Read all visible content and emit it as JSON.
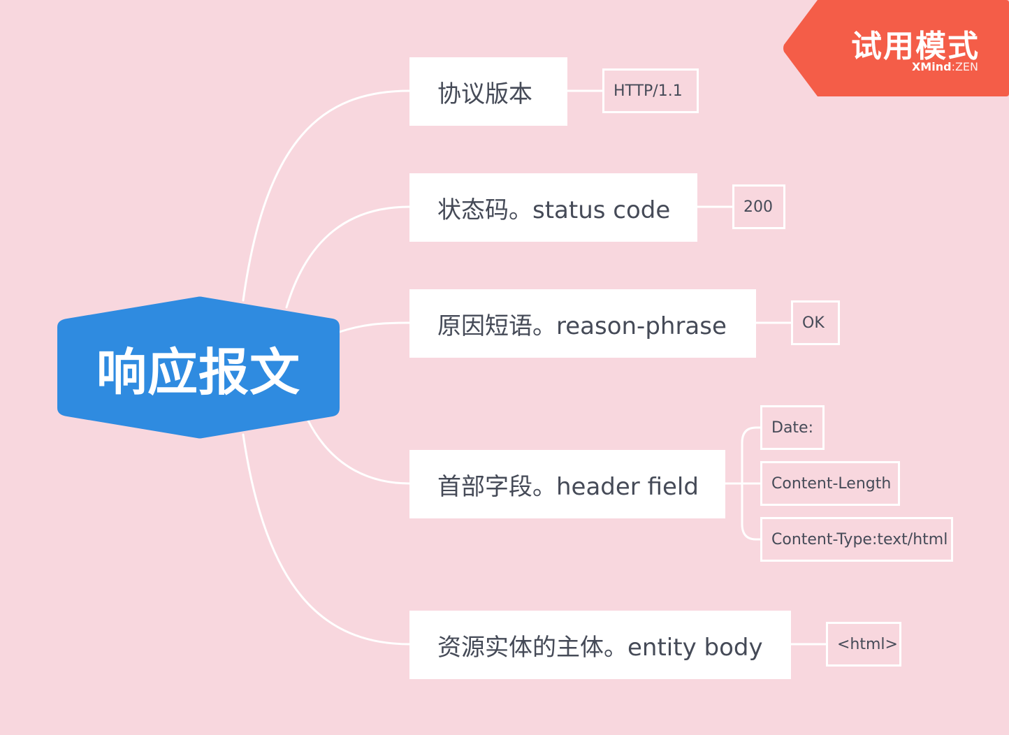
{
  "central_topic": "响应报文",
  "branches": [
    {
      "label": "协议版本",
      "children": [
        "HTTP/1.1"
      ]
    },
    {
      "label": "状态码。status code",
      "children": [
        "200"
      ]
    },
    {
      "label": "原因短语。reason-phrase",
      "children": [
        "OK"
      ]
    },
    {
      "label": "首部字段。header field",
      "children": [
        "Date:",
        "Content-Length",
        "Content-Type:text/html"
      ]
    },
    {
      "label": "资源实体的主体。entity body",
      "children": [
        "<html>"
      ]
    }
  ],
  "watermark": {
    "title": "试用模式",
    "brand_bold": "XMind",
    "brand_sep": ":",
    "brand_light": "ZEN"
  },
  "colors": {
    "background": "#f8d7de",
    "central": "#2f8be0",
    "topic_text": "#454a57",
    "connector": "#ffffff",
    "watermark": "#f45d48"
  }
}
